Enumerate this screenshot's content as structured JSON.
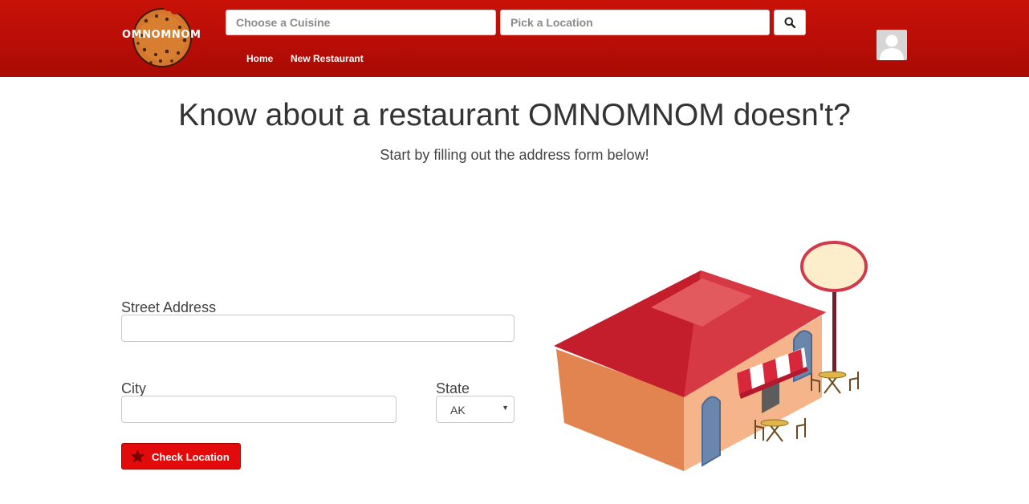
{
  "brand": {
    "name": "OMNOMNOM",
    "accent": "#c81208"
  },
  "search": {
    "cuisine_placeholder": "Choose a Cuisine",
    "location_placeholder": "Pick a Location",
    "button_icon": "search-icon"
  },
  "nav": {
    "items": [
      {
        "label": "Home"
      },
      {
        "label": "New Restaurant"
      }
    ]
  },
  "user": {
    "avatar_icon": "user-silhouette-icon"
  },
  "main": {
    "title": "Know about a restaurant OMNOMNOM doesn't?",
    "subtitle": "Start by filling out the address form below!"
  },
  "form": {
    "street_label": "Street Address",
    "street_value": "",
    "city_label": "City",
    "city_value": "",
    "state_label": "State",
    "state_value": "AK",
    "submit_label": "Check Location",
    "submit_icon": "star-icon",
    "submit_color": "#e20a0a"
  },
  "illustration": {
    "icon": "restaurant-building-illustration"
  }
}
